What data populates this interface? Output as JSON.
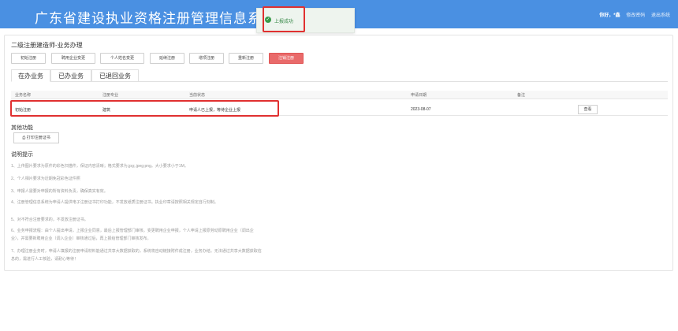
{
  "header": {
    "title": "广东省建设执业资格注册管理信息系统",
    "user": "你好，*鑫",
    "links": [
      "修改密码",
      "退出系统"
    ]
  },
  "toast": {
    "message": "上报成功",
    "status_color": "#3a9a4a"
  },
  "page": {
    "section_title": "二级注册建造师-业务办理"
  },
  "actions": [
    {
      "label": "初始注册"
    },
    {
      "label": "聘用企业变更"
    },
    {
      "label": "个人姓名变更"
    },
    {
      "label": "延续注册"
    },
    {
      "label": "增项注册"
    },
    {
      "label": "重新注册"
    },
    {
      "label": "注销注册"
    }
  ],
  "tabs": [
    {
      "label": "在办业务"
    },
    {
      "label": "已办业务"
    },
    {
      "label": "已退回业务"
    }
  ],
  "table": {
    "headers": [
      "业务名称",
      "注册专业",
      "当前状态",
      "申请日期",
      "备注"
    ],
    "rows": [
      {
        "name": "初始注册",
        "specialty": "建筑",
        "status": "申请人已上报，等待企业上报",
        "date": "2023-08-07",
        "remark": "",
        "action": "查看"
      }
    ]
  },
  "other": {
    "title": "其他功能",
    "print_label": "打印注册证书"
  },
  "notes": {
    "title": "说明提示",
    "items": [
      "1、上传图片要求为原件的彩色扫描件，保证内容清晰；格式要求为.jpg;.jpeg;png。大小要求小于1M。",
      "2、个人相片要求为近期免冠彩色证件照",
      "3、申报人需要对申报的所有资料负责，确保真实有效。",
      "4、注册管理信息系统为申请人提供电子注册证书打印功能，不发放纸质注册证书。执业印章请按照相关规定自行刻制。",
      "5、对不符合注册要求的，不发放注册证书。",
      "6、业务申报流程：由个人提出申请，上报企业同意，最后上报管理部门审核。变更聘用企业申报，个人申请上报原劳动原聘用企业（调出企业），并需要新聘用企业（调入企业）审核通过后，再上报给管理部门审核发布。",
      "7、办理注册业务时，申请人填报的注册申请材料能通过共享大数据获取的，系统将自动链接附件成注册，业务办结。无法通过共享大数据获取信息的，需进行人工核验，请耐心等待！"
    ]
  }
}
